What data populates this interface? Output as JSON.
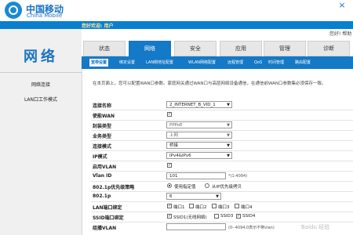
{
  "header": {
    "brand_cn": "中国移动",
    "brand_en": "China Mobile",
    "close": "×",
    "welcome": "您好欢迎: 用户",
    "side_text": "您好! 帮助"
  },
  "left": {
    "title": "网络",
    "items": [
      "网络连接",
      "LAN口工作模式"
    ]
  },
  "tabs": [
    "状态",
    "网络",
    "安全",
    "应用",
    "管理",
    "诊断"
  ],
  "subtabs": [
    "宽带设置",
    "绑定设置",
    "LAN侧地址配置",
    "WLAN网络配置",
    "远程管理",
    "QoS",
    "时间管理",
    "路由配置"
  ],
  "description": "在本页面上，您可以配置WAN口参数。家庭网关通过WAN口与高层网络设备通信，在通信前WAN口参数集必须保存一致。",
  "form": {
    "conn_name_label": "连接名称",
    "conn_name_value": "2_INTERNET_B_VID_1",
    "enable_wan_label": "使能WAN",
    "enc_type_label": "封装类型",
    "enc_type_value": "PPPoE",
    "service_label": "业务类型",
    "service_value": "上网",
    "conn_mode_label": "连接模式",
    "conn_mode_value": "桥接",
    "ip_mode_label": "IP模式",
    "ip_mode_value": "IPv4&IPv6",
    "enable_vlan_label": "启用VLAN",
    "vlan_id_label": "Vlan ID",
    "vlan_id_value": "101",
    "vlan_id_hint": "*(1-4094)",
    "p8021_policy_label": "802.1p优先级策略",
    "p8021_policy_opt1": "使用指定值",
    "p8021_policy_opt2": "从IP优先级拷贝",
    "p8021_label": "802.1p",
    "p8021_value": "6",
    "lan_bind_label": "LAN端口绑定",
    "lan_ports": [
      "端口1",
      "端口2",
      "端口3",
      "端口4"
    ],
    "ssid_bind_label": "SSID端口绑定",
    "ssids": [
      "SSID1(无线网络)",
      "SSID3",
      "SSID4"
    ],
    "mcast_vlan_label": "组播VLAN",
    "mcast_vlan_hint": "(0--4094,0表示不带vlan)"
  },
  "watermark": "Baidu 经验"
}
